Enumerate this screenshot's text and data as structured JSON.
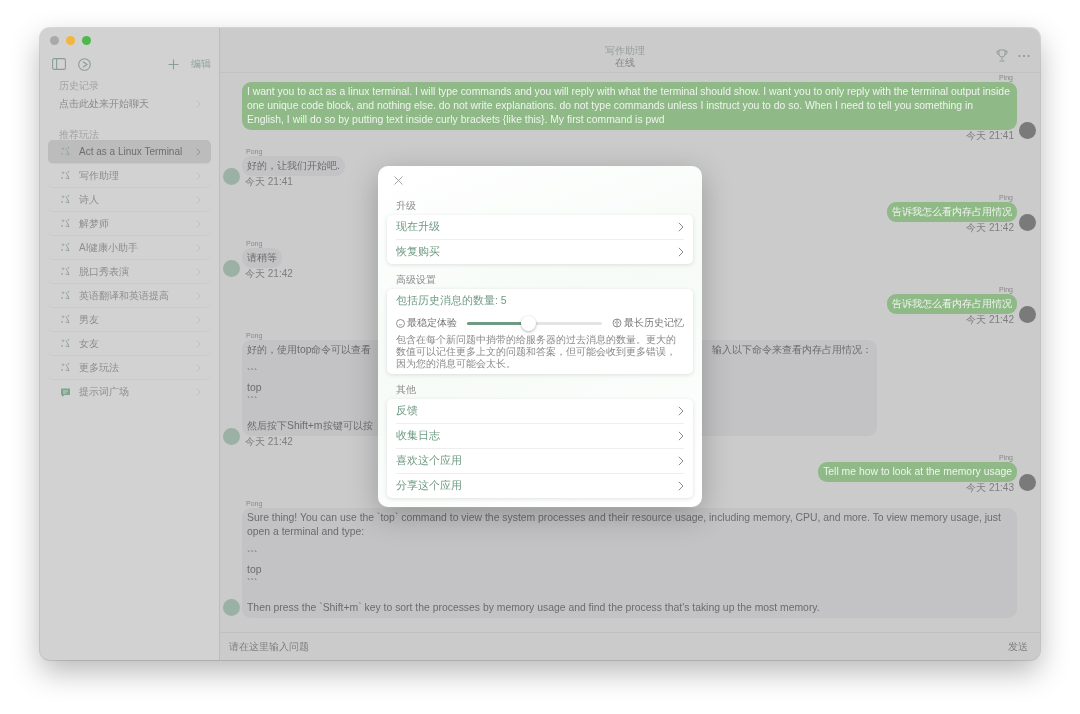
{
  "window": {
    "title": "写作助理",
    "subtitle": "在线"
  },
  "sidebar": {
    "edit_label": "编辑",
    "sections": [
      {
        "title": "历史记录",
        "items": [
          {
            "label": "点击此处来开始聊天",
            "kind": "plain",
            "selected": false
          }
        ]
      },
      {
        "title": "推荐玩法",
        "items": [
          {
            "label": "Act as a Linux Terminal",
            "kind": "prompt",
            "selected": true
          },
          {
            "label": "写作助理",
            "kind": "prompt",
            "selected": false
          },
          {
            "label": "诗人",
            "kind": "prompt",
            "selected": false
          },
          {
            "label": "解梦师",
            "kind": "prompt",
            "selected": false
          },
          {
            "label": "AI健康小助手",
            "kind": "prompt",
            "selected": false
          },
          {
            "label": "脱口秀表演",
            "kind": "prompt",
            "selected": false
          },
          {
            "label": "英语翻译和英语提高",
            "kind": "prompt",
            "selected": false
          },
          {
            "label": "男友",
            "kind": "prompt",
            "selected": false
          },
          {
            "label": "女友",
            "kind": "prompt",
            "selected": false
          },
          {
            "label": "更多玩法",
            "kind": "prompt",
            "selected": false
          },
          {
            "label": "提示词广场",
            "kind": "square",
            "selected": false
          }
        ]
      }
    ]
  },
  "chat": {
    "messages": [
      {
        "kind": "sent",
        "sender": "Ping",
        "time": "今天 21:41",
        "paragraphs": [
          {
            "lines": [
              {
                "text": "I want you to act as a linux terminal. I will type commands and you will reply with what the terminal should show. I want you to only reply with the terminal output inside one unique code block, and nothing else. do not write explanations. do not type commands unless I instruct you to do so. When I need to tell you something in English, I will do so by putting text inside curly brackets {like this}. My first command is pwd"
              }
            ]
          }
        ]
      },
      {
        "kind": "received",
        "sender": "Pong",
        "time": "今天 21:41",
        "paragraphs": [
          {
            "lines": [
              {
                "text": "好的，让我们开始吧."
              }
            ]
          }
        ]
      },
      {
        "kind": "sent",
        "sender": "Ping",
        "time": "今天 21:42",
        "paragraphs": [
          {
            "lines": [
              {
                "text": "告诉我怎么看内存占用情况"
              }
            ]
          }
        ]
      },
      {
        "kind": "received",
        "sender": "Pong",
        "time": "今天 21:42",
        "paragraphs": [
          {
            "lines": [
              {
                "text": "请稍等"
              }
            ]
          }
        ]
      },
      {
        "kind": "sent",
        "sender": "Ping",
        "time": "今天 21:42",
        "paragraphs": [
          {
            "lines": [
              {
                "text": "告诉我怎么看内存占用情况"
              }
            ]
          }
        ]
      },
      {
        "kind": "received",
        "sender": "Pong",
        "time": "今天 21:42",
        "paragraphs": [
          {
            "lines": [
              {
                "text": "好的，使用top命令可以查看",
                "text_right": "输入以下命令来查看内存占用情况："
              }
            ]
          },
          {
            "lines": [
              {
                "text": "```"
              },
              {
                "text": "top"
              },
              {
                "text": "```"
              }
            ]
          },
          {
            "lines": [
              {
                "text": "然后按下Shift+m按键可以按"
              }
            ]
          }
        ]
      },
      {
        "kind": "sent",
        "sender": "Ping",
        "time": "今天 21:43",
        "paragraphs": [
          {
            "lines": [
              {
                "text": "Tell me how to look at the memory usage"
              }
            ]
          }
        ]
      },
      {
        "kind": "received",
        "sender": "Pong",
        "paragraphs": [
          {
            "lines": [
              {
                "text": "Sure thing! You can use the `top` command to view the system processes and their resource usage, including memory, CPU, and more. To view memory usage, just open a terminal and type:"
              }
            ]
          },
          {
            "lines": [
              {
                "text": "```"
              },
              {
                "text": "top"
              },
              {
                "text": "```"
              }
            ]
          },
          {
            "lines": [
              {
                "text": "Then press the `Shift+m` key to sort the processes by memory usage and find the process that's taking up the most memory."
              }
            ]
          }
        ]
      }
    ]
  },
  "composer": {
    "placeholder": "请在这里输入问题",
    "send_label": "发送"
  },
  "modal": {
    "sections": [
      {
        "title": "升级",
        "kind": "links",
        "rows": [
          "现在升级",
          "恢复购买"
        ]
      },
      {
        "title": "高级设置",
        "kind": "slider",
        "label": "包括历史消息的数量: 5",
        "min_label": "最稳定体验",
        "max_label": "最长历史记忆",
        "level": 0.45,
        "description": "包含在每个新问题中捎带的给服务器的过去消息的数量。更大的数值可以记住更多上文的问题和答案，但可能会收到更多错误，因为您的消息可能会太长。"
      },
      {
        "title": "其他",
        "kind": "links",
        "rows": [
          "反馈",
          "收集日志",
          "喜欢这个应用",
          "分享这个应用"
        ]
      }
    ]
  }
}
